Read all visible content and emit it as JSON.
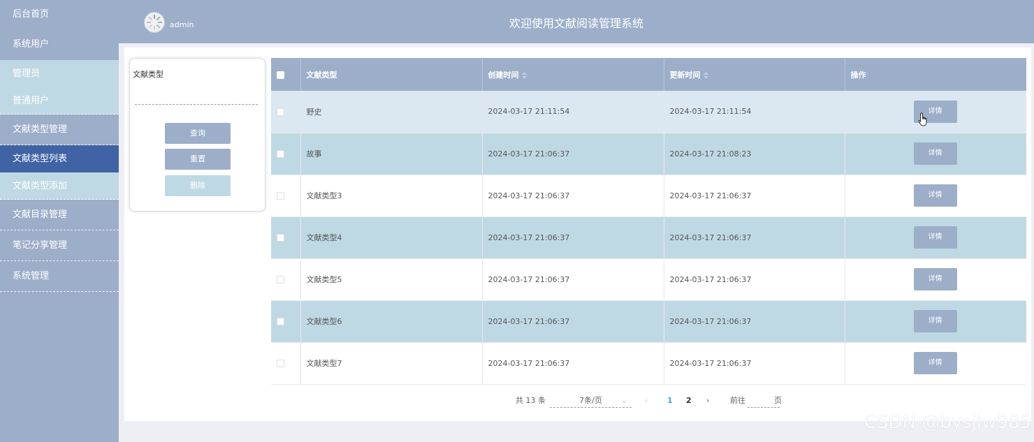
{
  "sidebar": {
    "items": [
      {
        "label": "后台首页"
      },
      {
        "label": "系统用户"
      },
      {
        "label": "管理员"
      },
      {
        "label": "普通用户"
      },
      {
        "label": "文献类型管理"
      },
      {
        "label": "文献类型列表"
      },
      {
        "label": "文献类型添加"
      },
      {
        "label": "文献目录管理"
      },
      {
        "label": "笔记分享管理"
      },
      {
        "label": "系统管理"
      }
    ]
  },
  "header": {
    "username": "admin",
    "title": "欢迎使用文献阅读管理系统"
  },
  "search": {
    "label": "文献类型",
    "value": "",
    "query_label": "查询",
    "reset_label": "重置",
    "delete_label": "删除"
  },
  "table": {
    "headers": [
      "文献类型",
      "创建时间",
      "更新时间",
      "操作"
    ],
    "detail_label": "详情",
    "rows": [
      {
        "type": "野史",
        "created": "2024-03-17 21:11:54",
        "updated": "2024-03-17 21:11:54"
      },
      {
        "type": "故事",
        "created": "2024-03-17 21:06:37",
        "updated": "2024-03-17 21:08:23"
      },
      {
        "type": "文献类型3",
        "created": "2024-03-17 21:06:37",
        "updated": "2024-03-17 21:06:37"
      },
      {
        "type": "文献类型4",
        "created": "2024-03-17 21:06:37",
        "updated": "2024-03-17 21:06:37"
      },
      {
        "type": "文献类型5",
        "created": "2024-03-17 21:06:37",
        "updated": "2024-03-17 21:06:37"
      },
      {
        "type": "文献类型6",
        "created": "2024-03-17 21:06:37",
        "updated": "2024-03-17 21:06:37"
      },
      {
        "type": "文献类型7",
        "created": "2024-03-17 21:06:37",
        "updated": "2024-03-17 21:06:37"
      }
    ]
  },
  "pagination": {
    "total": "共 13 条",
    "page_size": "7条/页",
    "prev": "‹",
    "page1": "1",
    "page2": "2",
    "next": "›",
    "goto": "前往",
    "page_suffix": "页"
  },
  "watermark": "CSDN @bysjlw985",
  "colors": {
    "primary": "#9daec9",
    "active": "#3f63a4",
    "light": "#bfd9e4",
    "link": "#409eff"
  }
}
